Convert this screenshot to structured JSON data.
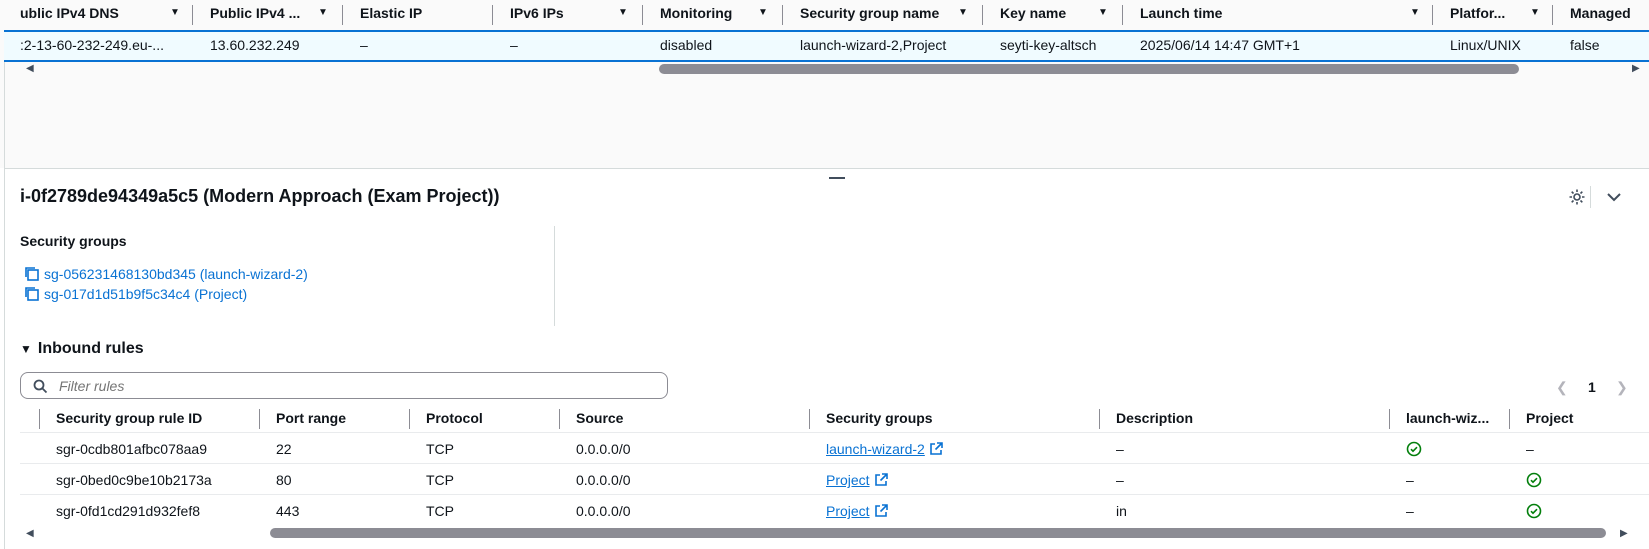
{
  "instances_table": {
    "columns": [
      {
        "label": "ublic IPv4 DNS"
      },
      {
        "label": "Public IPv4 ..."
      },
      {
        "label": "Elastic IP"
      },
      {
        "label": "IPv6 IPs"
      },
      {
        "label": "Monitoring"
      },
      {
        "label": "Security group name"
      },
      {
        "label": "Key name"
      },
      {
        "label": "Launch time"
      },
      {
        "label": "Platfor..."
      },
      {
        "label": "Managed"
      }
    ],
    "selected_row": {
      "public_dns": ":2-13-60-232-249.eu-...",
      "public_ipv4": "13.60.232.249",
      "elastic_ip": "–",
      "ipv6": "–",
      "monitoring": "disabled",
      "security_group_name": "launch-wizard-2,Project",
      "key_name": "seyti-key-altsch",
      "launch_time": "2025/06/14 14:47 GMT+1",
      "platform": "Linux/UNIX",
      "managed": "false"
    }
  },
  "details_panel": {
    "title": "i-0f2789de94349a5c5 (Modern Approach (Exam Project))",
    "security_groups_label": "Security groups",
    "security_groups": [
      {
        "text": "sg-056231468130bd345 (launch-wizard-2)"
      },
      {
        "text": "sg-017d1d51b9f5c34c4 (Project)"
      }
    ],
    "inbound_rules_label": "Inbound rules",
    "filter_placeholder": "Filter rules",
    "page_number": "1",
    "rules_table": {
      "columns": [
        "Security group rule ID",
        "Port range",
        "Protocol",
        "Source",
        "Security groups",
        "Description",
        "launch-wiz...",
        "Project"
      ],
      "rows": [
        {
          "id": "sgr-0cdb801afbc078aa9",
          "port": "22",
          "protocol": "TCP",
          "source": "0.0.0.0/0",
          "sg": "launch-wizard-2",
          "description": "–",
          "launch_wizard": "check",
          "project": "–"
        },
        {
          "id": "sgr-0bed0c9be10b2173a",
          "port": "80",
          "protocol": "TCP",
          "source": "0.0.0.0/0",
          "sg": "Project",
          "description": "–",
          "launch_wizard": "–",
          "project": "check"
        },
        {
          "id": "sgr-0fd1cd291d932fef8",
          "port": "443",
          "protocol": "TCP",
          "source": "0.0.0.0/0",
          "sg": "Project",
          "description": "in",
          "launch_wizard": "–",
          "project": "check"
        }
      ]
    }
  },
  "colors": {
    "link": "#0972d3",
    "success": "#037f0c",
    "selected_bg": "#f0fbff",
    "border": "#8c8c94"
  }
}
